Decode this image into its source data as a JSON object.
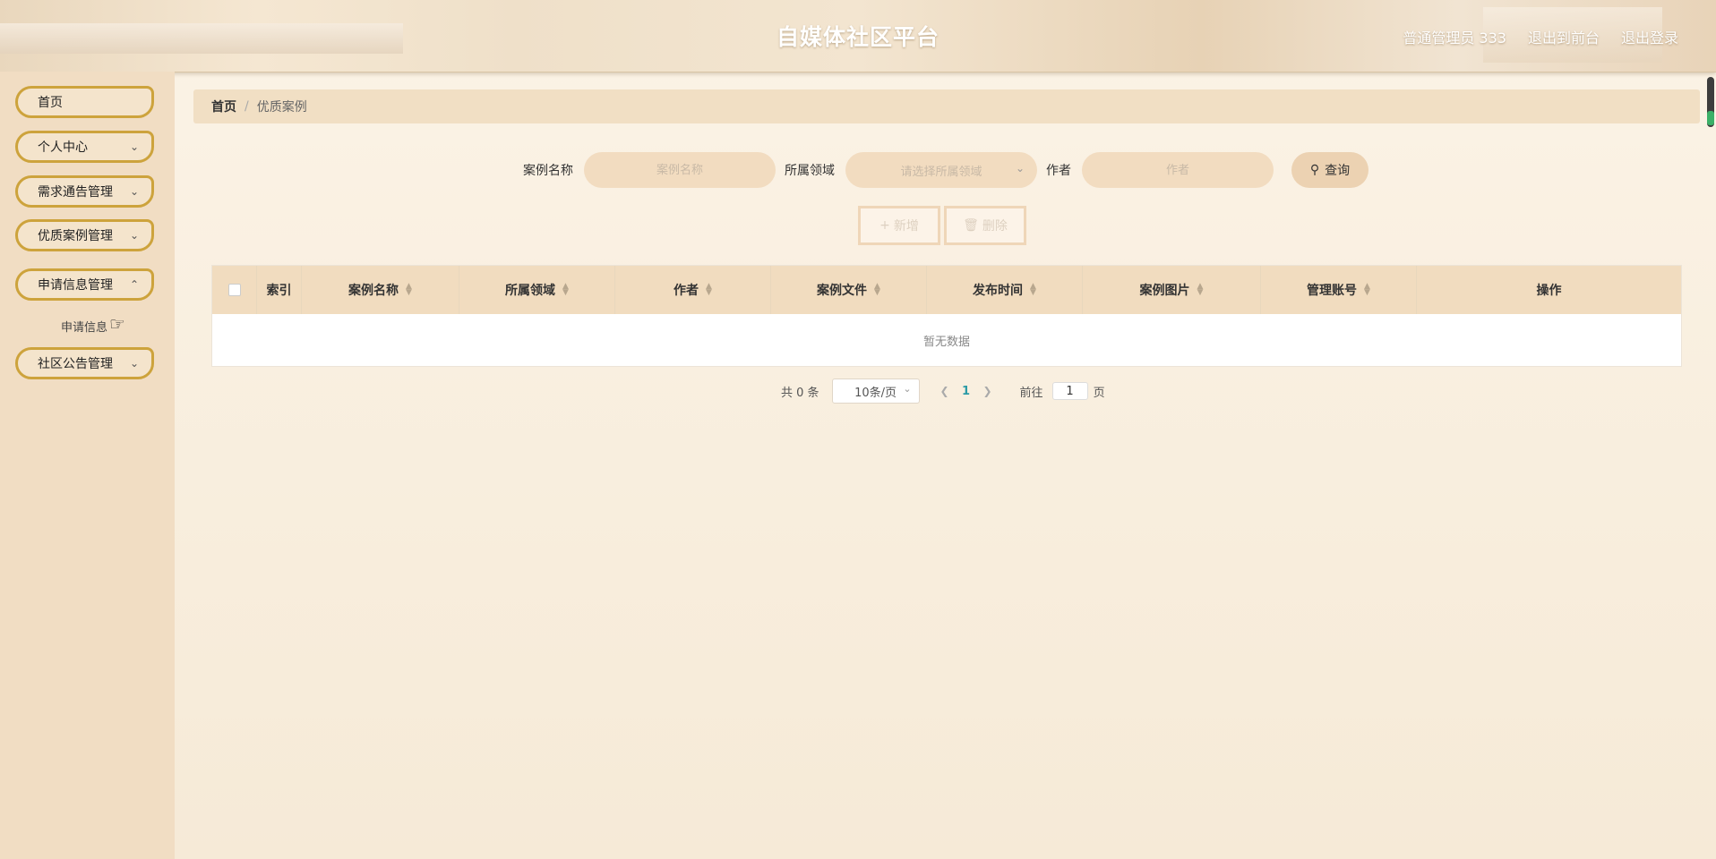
{
  "header": {
    "title": "自媒体社区平台",
    "user_label": "普通管理员 333",
    "exit_front_label": "退出到前台",
    "logout_label": "退出登录"
  },
  "sidebar": {
    "items": [
      {
        "label": "首页"
      },
      {
        "label": "个人中心"
      },
      {
        "label": "需求通告管理"
      },
      {
        "label": "优质案例管理"
      },
      {
        "label": "申请信息管理"
      },
      {
        "label": "社区公告管理"
      }
    ],
    "submenu": {
      "label": "申请信息"
    }
  },
  "breadcrumb": {
    "home": "首页",
    "current": "优质案例"
  },
  "search": {
    "case_name_label": "案例名称",
    "case_name_placeholder": "案例名称",
    "domain_label": "所属领域",
    "domain_placeholder": "请选择所属领域",
    "author_label": "作者",
    "author_placeholder": "作者",
    "query_label": "查询"
  },
  "actions": {
    "add_label": "新增",
    "delete_label": "删除"
  },
  "table": {
    "columns": [
      "索引",
      "案例名称",
      "所属领域",
      "作者",
      "案例文件",
      "发布时间",
      "案例图片",
      "管理账号",
      "操作"
    ],
    "empty_text": "暂无数据"
  },
  "pagination": {
    "total_text": "共 0 条",
    "page_size": "10条/页",
    "current_page": "1",
    "goto_prefix": "前往",
    "goto_value": "1",
    "goto_suffix": "页"
  },
  "colors": {
    "accent": "#cda33c",
    "sidebar_bg": "#f1ddc3",
    "header_bg": "#efe0c9",
    "table_header_bg": "#f1dcbf",
    "page_active": "#2c9ba6"
  }
}
